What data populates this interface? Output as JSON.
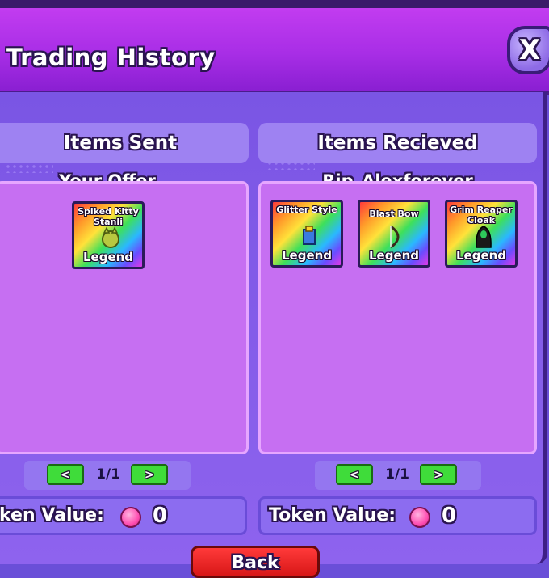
{
  "header": {
    "title": "Trading History",
    "close_symbol": "X"
  },
  "sent": {
    "heading": "Items Sent",
    "owner": "Your Offer",
    "items": [
      {
        "name": "Spiked Kitty Stanli",
        "rarity": "Legend",
        "icon": "kitty-icon"
      }
    ],
    "page": "1/1",
    "prev": "<",
    "next": ">",
    "token_label": "ken Value:",
    "token_value": "0"
  },
  "received": {
    "heading": "Items Recieved",
    "owner": "Rip_Alexforever",
    "items": [
      {
        "name": "Glitter Style",
        "rarity": "Legend",
        "icon": "glitter-icon"
      },
      {
        "name": "Blast Bow",
        "rarity": "Legend",
        "icon": "bow-icon"
      },
      {
        "name": "Grim Reaper Cloak",
        "rarity": "Legend",
        "icon": "cloak-icon"
      }
    ],
    "page": "1/1",
    "prev": "<",
    "next": ">",
    "token_label": "Token Value:",
    "token_value": "0"
  },
  "footer": {
    "back_label": "Back"
  },
  "colors": {
    "header": "#b235ea",
    "panel": "#c66ff2",
    "button_green": "#3fdc3a",
    "token_pink": "#ff4fb2"
  }
}
